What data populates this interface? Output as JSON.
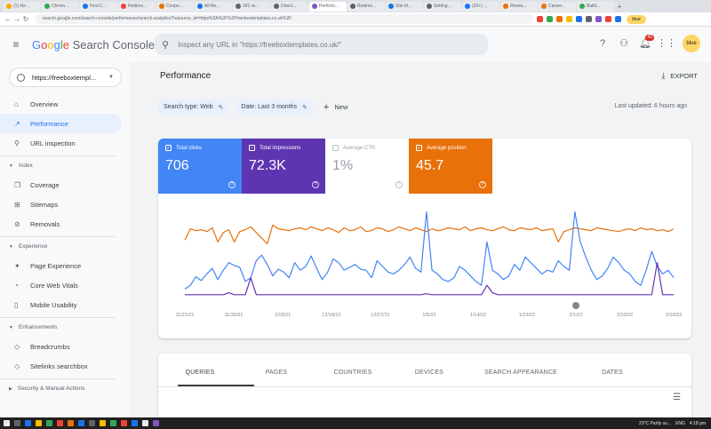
{
  "browser": {
    "tabs": [
      {
        "label": "(1) Re...",
        "color": "#f9ab00",
        "active": false
      },
      {
        "label": "Chrom...",
        "color": "#34a853",
        "active": false
      },
      {
        "label": "Find C...",
        "color": "#1a73e8",
        "active": false
      },
      {
        "label": "Redirec...",
        "color": "#ea4335",
        "active": false
      },
      {
        "label": "Coope...",
        "color": "#e8710a",
        "active": false
      },
      {
        "label": "All Re...",
        "color": "#1a73e8",
        "active": false
      },
      {
        "label": "301 re...",
        "color": "#5f6368",
        "active": false
      },
      {
        "label": "Direct...",
        "color": "#5f6368",
        "active": false
      },
      {
        "label": "Perform...",
        "color": "#7e57c2",
        "active": true
      },
      {
        "label": "Redirec...",
        "color": "#5f6368",
        "active": false
      },
      {
        "label": "Site tit...",
        "color": "#1a73e8",
        "active": false
      },
      {
        "label": "Setting...",
        "color": "#5f6368",
        "active": false
      },
      {
        "label": "(20+) ...",
        "color": "#1877f2",
        "active": false
      },
      {
        "label": "Resea...",
        "color": "#e8710a",
        "active": false
      },
      {
        "label": "Caram...",
        "color": "#e8710a",
        "active": false
      },
      {
        "label": "Build...",
        "color": "#34a853",
        "active": false
      }
    ],
    "url": "search.google.com/search-console/performance/search-analytics?resource_id=https%3A%2F%2Ffreeboxtemplates.co.uk%2F",
    "extension_colors": [
      "#ea4335",
      "#34a853",
      "#e8710a",
      "#fbbc05",
      "#1a73e8",
      "#5f6368",
      "#7e57c2",
      "#ea4335",
      "#1a73e8"
    ],
    "profile_label": "blue"
  },
  "header": {
    "logo_parts": [
      "G",
      "o",
      "o",
      "g",
      "l",
      "e"
    ],
    "logo_product": "Search Console",
    "search_placeholder": "Inspect any URL in \"https://freeboxtemplates.co.uk/\"",
    "notification_count": "43",
    "avatar_text": "blue"
  },
  "sidebar": {
    "property": "https://freeboxtempl...",
    "items_top": [
      {
        "label": "Overview",
        "icon": "home-icon",
        "glyph": "⌂",
        "active": false
      },
      {
        "label": "Performance",
        "icon": "trend-icon",
        "glyph": "↗",
        "active": true
      },
      {
        "label": "URL inspection",
        "icon": "search-icon",
        "glyph": "⚲",
        "active": false
      }
    ],
    "section_index": "Index",
    "items_index": [
      {
        "label": "Coverage",
        "icon": "coverage-icon",
        "glyph": "❐"
      },
      {
        "label": "Sitemaps",
        "icon": "sitemap-icon",
        "glyph": "⊞"
      },
      {
        "label": "Removals",
        "icon": "removals-icon",
        "glyph": "⊘"
      }
    ],
    "section_experience": "Experience",
    "items_experience": [
      {
        "label": "Page Experience",
        "icon": "page-experience-icon",
        "glyph": "✦"
      },
      {
        "label": "Core Web Vitals",
        "icon": "vitals-icon",
        "glyph": "◔"
      },
      {
        "label": "Mobile Usability",
        "icon": "mobile-icon",
        "glyph": "▯"
      }
    ],
    "section_enhancements": "Enhancements",
    "items_enhancements": [
      {
        "label": "Breadcrumbs",
        "icon": "breadcrumbs-icon",
        "glyph": "◇"
      },
      {
        "label": "Sitelinks searchbox",
        "icon": "sitelinks-icon",
        "glyph": "◇"
      }
    ],
    "section_security": "Security & Manual Actions"
  },
  "main": {
    "title": "Performance",
    "export_label": "EXPORT",
    "filter_search_type": "Search type: Web",
    "filter_date": "Date: Last 3 months",
    "new_label": "New",
    "last_updated": "Last updated: 6 hours ago",
    "metrics": [
      {
        "label": "Total clicks",
        "value": "706",
        "checked": true
      },
      {
        "label": "Total impressions",
        "value": "72.3K",
        "checked": true
      },
      {
        "label": "Average CTR",
        "value": "1%",
        "checked": false
      },
      {
        "label": "Average position",
        "value": "45.7",
        "checked": true
      }
    ],
    "dimension_tabs": [
      "QUERIES",
      "PAGES",
      "COUNTRIES",
      "DEVICES",
      "SEARCH APPEARANCE",
      "DATES"
    ],
    "active_tab": "QUERIES"
  },
  "chart_data": {
    "type": "line",
    "x_tick_labels": [
      "11/21/21",
      "11/30/21",
      "12/9/21",
      "12/18/21",
      "12/27/21",
      "1/5/22",
      "1/14/22",
      "1/23/22",
      "2/1/22",
      "2/10/22",
      "2/19/22"
    ],
    "annotation_marker_at": "2/1/22",
    "series": [
      {
        "color": "#e8710a",
        "values": [
          62,
          74,
          72,
          73,
          71,
          75,
          60,
          70,
          73,
          60,
          71,
          73,
          76,
          70,
          64,
          58,
          78,
          74,
          73,
          72,
          74,
          75,
          73,
          76,
          74,
          72,
          75,
          73,
          70,
          75,
          72,
          73,
          76,
          71,
          72,
          75,
          74,
          71,
          73,
          76,
          74,
          72,
          75,
          73,
          71,
          74,
          72,
          73,
          75,
          74,
          73,
          76,
          72,
          74,
          75,
          73,
          72,
          74,
          76,
          73,
          72,
          75,
          74,
          73,
          75,
          72,
          73,
          74,
          60,
          71,
          73,
          75,
          74,
          73,
          72,
          75,
          74,
          73,
          72,
          71,
          73,
          74,
          72,
          75,
          73,
          74,
          72,
          73,
          71,
          74
        ]
      },
      {
        "color": "#4285f4",
        "values": [
          10,
          14,
          23,
          19,
          26,
          32,
          20,
          30,
          38,
          35,
          33,
          18,
          22,
          40,
          46,
          36,
          24,
          31,
          28,
          22,
          38,
          30,
          34,
          45,
          32,
          20,
          28,
          42,
          38,
          30,
          33,
          36,
          31,
          30,
          22,
          40,
          34,
          28,
          26,
          30,
          36,
          44,
          32,
          28,
          92,
          30,
          26,
          20,
          18,
          22,
          34,
          30,
          24,
          18,
          14,
          60,
          30,
          26,
          20,
          24,
          36,
          30,
          44,
          38,
          32,
          26,
          30,
          28,
          40,
          34,
          30,
          92,
          60,
          44,
          30,
          20,
          24,
          32,
          44,
          38,
          30,
          26,
          18,
          14,
          30,
          50,
          34,
          26,
          30,
          22
        ]
      },
      {
        "color": "#5e35b1",
        "values": [
          4,
          4,
          4,
          4,
          4,
          4,
          4,
          4,
          6,
          4,
          4,
          4,
          22,
          4,
          4,
          4,
          4,
          4,
          4,
          4,
          4,
          4,
          4,
          4,
          4,
          4,
          4,
          4,
          4,
          4,
          4,
          4,
          4,
          4,
          4,
          4,
          4,
          4,
          4,
          4,
          4,
          4,
          4,
          4,
          5,
          4,
          4,
          4,
          4,
          4,
          4,
          4,
          4,
          4,
          4,
          14,
          6,
          4,
          4,
          4,
          4,
          4,
          4,
          4,
          4,
          4,
          4,
          4,
          4,
          4,
          4,
          4,
          4,
          4,
          4,
          4,
          4,
          4,
          4,
          4,
          4,
          4,
          4,
          4,
          4,
          4,
          38,
          4,
          4,
          4
        ]
      }
    ]
  },
  "taskbar": {
    "weather": "23°C Partly su...",
    "lang": "ENG",
    "time": "4:18 pm",
    "icon_colors": [
      "#e8eaed",
      "#5f6368",
      "#1a73e8",
      "#fbbc05",
      "#34a853",
      "#ea4335",
      "#e8710a",
      "#1a73e8",
      "#5f6368",
      "#fbbc05",
      "#34a853",
      "#ea4335",
      "#1a73e8",
      "#e8eaed",
      "#7e57c2"
    ]
  }
}
